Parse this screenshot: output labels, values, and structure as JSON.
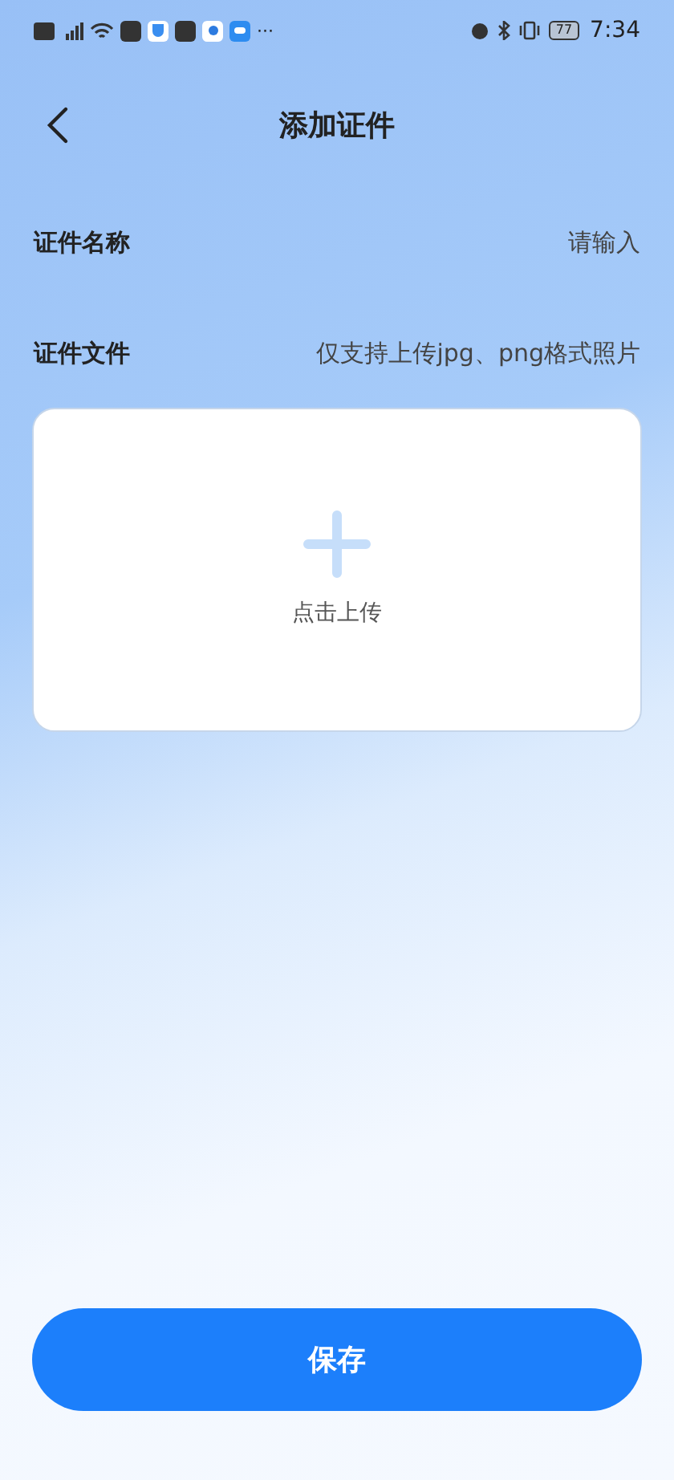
{
  "status_bar": {
    "overflow": "···",
    "battery": "77",
    "time": "7:34"
  },
  "header": {
    "title": "添加证件"
  },
  "form": {
    "name_field": {
      "label": "证件名称",
      "placeholder": "请输入"
    },
    "file_field": {
      "label": "证件文件",
      "hint": "仅支持上传jpg、png格式照片"
    },
    "upload": {
      "label": "点击上传"
    }
  },
  "save_button": {
    "label": "保存"
  }
}
